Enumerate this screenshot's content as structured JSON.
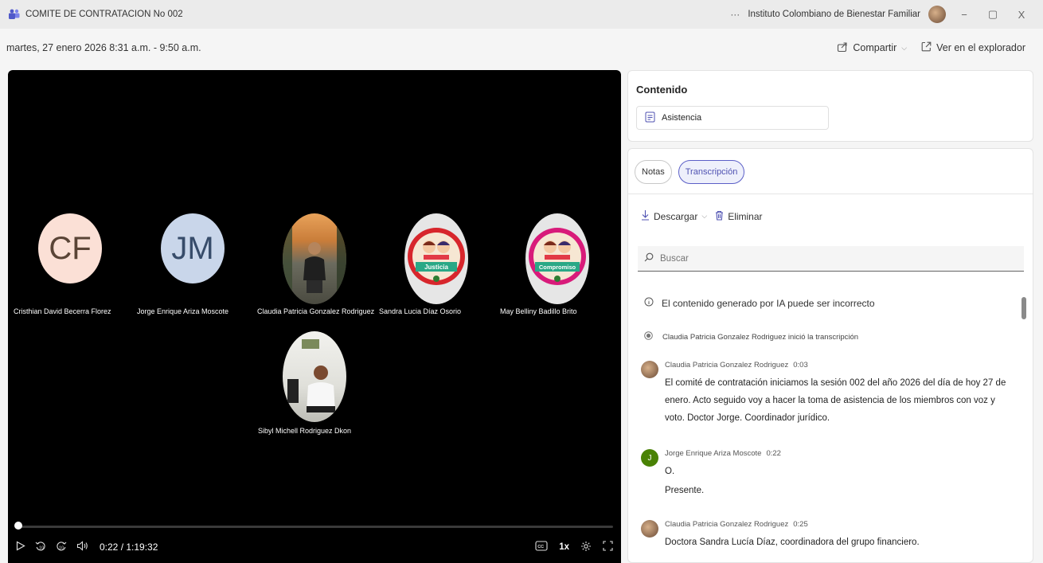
{
  "window": {
    "title": "COMITE DE CONTRATACION No 002",
    "more": "···",
    "organization": "Instituto Colombiano de Bienestar Familiar",
    "minimize": "−",
    "restore": "▢",
    "close": "X"
  },
  "header": {
    "date": "martes, 27 enero 2026 8:31 a.m. - 9:50 a.m.",
    "share_label": "Compartir",
    "explorer_label": "Ver en el explorador"
  },
  "participants": [
    {
      "name": "Cristhian David Becerra Florez",
      "initials": "CF",
      "bg": "#fbe0d6"
    },
    {
      "name": "Jorge Enrique Ariza Moscote",
      "initials": "JM",
      "bg": "#c9d6ea"
    },
    {
      "name": "Claudia Patricia Gonzalez Rodriguez",
      "initials": ""
    },
    {
      "name": "Sandra Lucia Díaz Osorio",
      "initials": "",
      "badge": "Justicia"
    },
    {
      "name": "May Belliny Badillo Brito",
      "initials": "",
      "badge": "Compromiso"
    },
    {
      "name": "Sibyl Michell Rodriguez Dkon",
      "initials": ""
    }
  ],
  "player": {
    "time": "0:22 / 1:19:32",
    "progress": 0.005,
    "speed": "1x",
    "skip_back": "10",
    "skip_forward": "10"
  },
  "content_panel": {
    "heading": "Contenido",
    "item": "Asistencia"
  },
  "transcript_panel": {
    "tabs": [
      "Notas",
      "Transcripción"
    ],
    "active_tab": 1,
    "download": "Descargar",
    "delete": "Eliminar",
    "search_placeholder": "Buscar",
    "ai_note": "El contenido generado por IA puede ser incorrecto",
    "started": "Claudia Patricia Gonzalez Rodriguez inició la transcripción",
    "entries": [
      {
        "speaker": "Claudia Patricia Gonzalez Rodriguez",
        "time": "0:03",
        "lines": [
          "El comité de contratación iniciamos la sesión 002 del año 2026 del día de hoy 27 de enero. Acto seguido voy a hacer la toma de asistencia de los miembros con voz y voto. Doctor Jorge. Coordinador jurídico."
        ]
      },
      {
        "speaker": "Jorge Enrique Ariza Moscote",
        "time": "0:22",
        "initial": "J",
        "lines": [
          "O.",
          "Presente."
        ]
      },
      {
        "speaker": "Claudia Patricia Gonzalez Rodriguez",
        "time": "0:25",
        "lines": [
          "Doctora Sandra Lucía Díaz, coordinadora del grupo financiero."
        ]
      }
    ]
  },
  "colors": {
    "accent": "#5b5fc7",
    "video_bg": "#000000",
    "jorge_avatar": "#498205"
  }
}
